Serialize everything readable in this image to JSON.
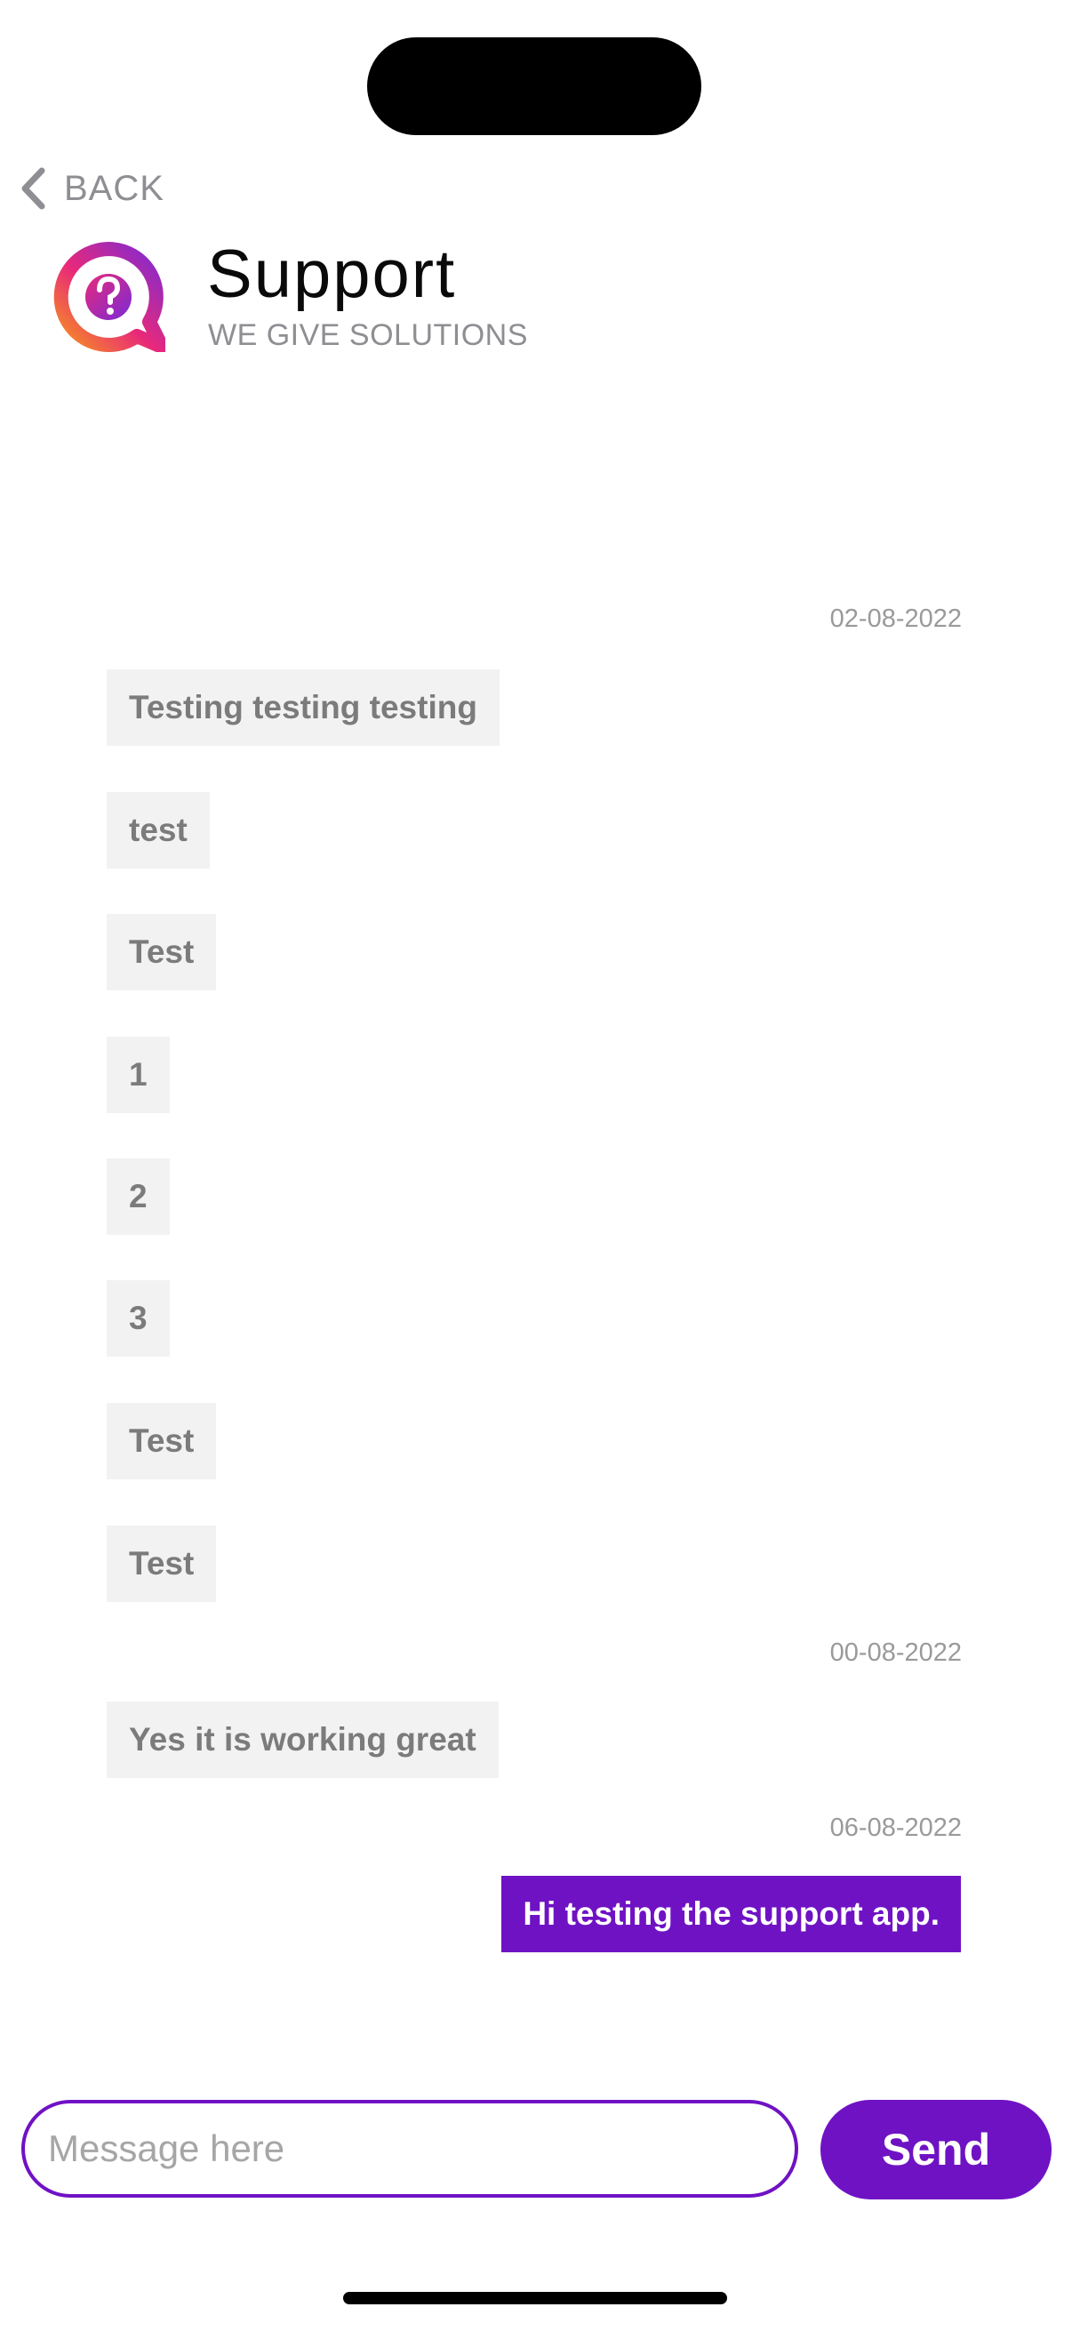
{
  "nav": {
    "back_label": "BACK"
  },
  "header": {
    "title": "Support",
    "subtitle": "WE GIVE SOLUTIONS"
  },
  "conversation": {
    "groups": [
      {
        "date": "02-08-2022",
        "messages": [
          {
            "text": "Testing testing testing",
            "direction": "incoming"
          },
          {
            "text": "test",
            "direction": "incoming"
          },
          {
            "text": "Test",
            "direction": "incoming"
          },
          {
            "text": "1",
            "direction": "incoming"
          },
          {
            "text": "2",
            "direction": "incoming"
          },
          {
            "text": "3",
            "direction": "incoming"
          },
          {
            "text": "Test",
            "direction": "incoming"
          },
          {
            "text": "Test",
            "direction": "incoming"
          }
        ]
      },
      {
        "date": "00-08-2022",
        "messages": [
          {
            "text": "Yes it is working great",
            "direction": "incoming"
          }
        ]
      },
      {
        "date": "06-08-2022",
        "messages": [
          {
            "text": "Hi testing the support app.",
            "direction": "outgoing"
          }
        ]
      }
    ]
  },
  "composer": {
    "placeholder": "Message here",
    "value": "",
    "send_label": "Send"
  },
  "colors": {
    "accent": "#6f12c4",
    "bubble_incoming": "#f3f2f2",
    "text_muted": "#8e8e93"
  },
  "icons": {
    "back": "chevron-left-icon",
    "logo": "question-chat-bubble-logo"
  }
}
